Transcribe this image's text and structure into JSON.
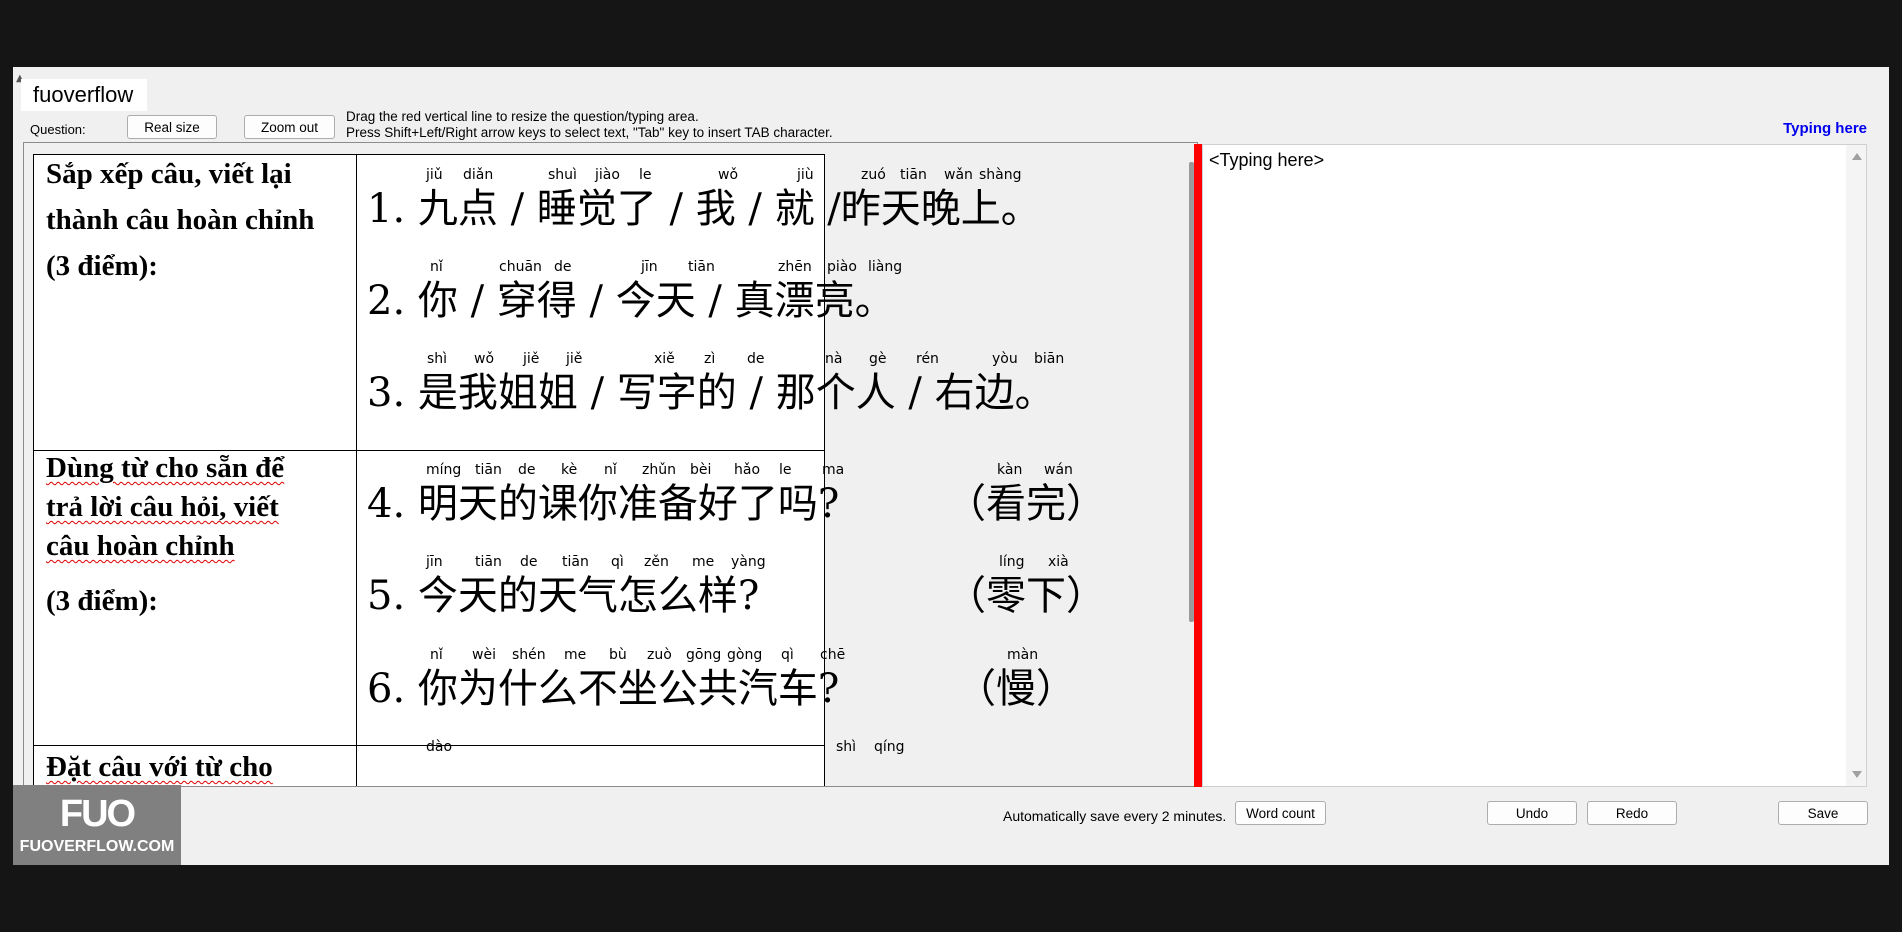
{
  "app": {
    "tab_title": "fuoverflow",
    "question_label": "Question:",
    "real_size_label": "Real size",
    "zoom_out_label": "Zoom out",
    "hint_line1": "Drag the red vertical line to resize the question/typing area.",
    "hint_line2": "Press Shift+Left/Right arrow keys to select text, \"Tab\" key to insert TAB character.",
    "typing_here_link": "Typing here"
  },
  "typing": {
    "content": "<Typing here>"
  },
  "footer": {
    "autosave_text": "Automatically save every 2 minutes.",
    "word_count_label": "Word count",
    "undo_label": "Undo",
    "redo_label": "Redo",
    "save_label": "Save"
  },
  "logo": {
    "mark": "FUO",
    "text": "FUOVERFLOW.COM"
  },
  "sheet": {
    "section1": {
      "line1": "Sắp xếp câu, viết lại",
      "line2": "thành câu hoàn chỉnh",
      "line3": "(3 điểm):"
    },
    "section2": {
      "line1": "Dùng từ cho sẵn để",
      "line2": "trả lời câu hỏi, viết",
      "line3": "câu hoàn chỉnh",
      "line4": "(3 điểm):"
    },
    "section3": {
      "line1": "Đặt câu với từ cho"
    },
    "q1": {
      "hanzi": "1. 九点 / 睡觉了 / 我 / 就 /昨天晚上。",
      "pinyin": [
        "jiǔ",
        "diǎn",
        "shuì",
        "jiào",
        "le",
        "wǒ",
        "jiù",
        "zuó",
        "tiān",
        "wǎn",
        "shàng"
      ]
    },
    "q2": {
      "hanzi": "2. 你 / 穿得 /  今天  / 真漂亮。",
      "pinyin": [
        "nǐ",
        "chuān",
        "de",
        "jīn",
        "tiān",
        "zhēn",
        "piào",
        "liàng"
      ]
    },
    "q3": {
      "hanzi": "3. 是我姐姐 /  写字的 / 那个人 / 右边。",
      "pinyin": [
        "shì",
        "wǒ",
        "jiě",
        "jiě",
        "xiě",
        "zì",
        "de",
        "nà",
        "gè",
        "rén",
        "yòu",
        "biān"
      ]
    },
    "q4": {
      "hanzi": "4. 明天的课你准备好了吗?",
      "hint": "（看完）",
      "pinyin": [
        "míng",
        "tiān",
        "de",
        "kè",
        "nǐ",
        "zhǔn",
        "bèi",
        "hǎo",
        "le",
        "ma"
      ],
      "hint_pinyin": [
        "kàn",
        "wán"
      ]
    },
    "q5": {
      "hanzi": "5. 今天的天气怎么样?",
      "hint": "（零下）",
      "pinyin": [
        "jīn",
        "tiān",
        "de",
        "tiān",
        "qì",
        "zěn",
        "me",
        "yàng"
      ],
      "hint_pinyin": [
        "líng",
        "xià"
      ]
    },
    "q6": {
      "hanzi": "6. 你为什么不坐公共汽车?",
      "hint": "（慢）",
      "pinyin": [
        "nǐ",
        "wèi",
        "shén",
        "me",
        "bù",
        "zuò",
        "gōng",
        "gòng",
        "qì",
        "chē"
      ],
      "hint_pinyin": [
        "màn"
      ]
    },
    "q7_pinyin": [
      "dào"
    ],
    "q8_pinyin": [
      "shì",
      "qíng"
    ]
  }
}
